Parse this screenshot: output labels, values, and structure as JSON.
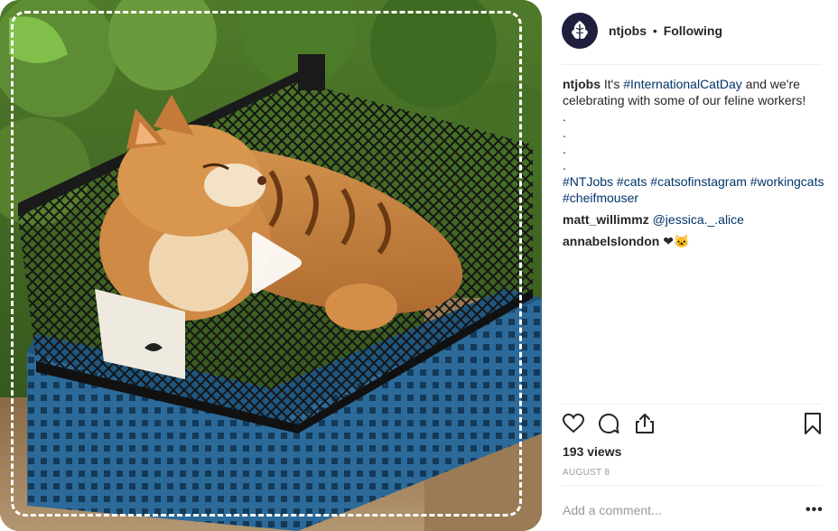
{
  "post": {
    "username": "ntjobs",
    "separator": "•",
    "follow_status": "Following",
    "caption_user": "ntjobs",
    "caption_text_1": " It's ",
    "caption_tag_1": "#InternationalCatDay",
    "caption_text_2": " and we're celebrating with some of our feline workers!",
    "caption_dots": [
      ".",
      ".",
      ".",
      "."
    ],
    "hashtags": [
      "#NTJobs",
      "#cats",
      "#catsofinstagram",
      "#workingcats",
      "#cheifmouser"
    ],
    "comments": [
      {
        "user": "matt_willimmz",
        "text": "@jessica._.alice"
      },
      {
        "user": "annabelslondon",
        "text": "❤🐱"
      }
    ],
    "views": "193 views",
    "date": "AUGUST 8",
    "add_comment_placeholder": "Add a comment...",
    "more_label": "•••"
  },
  "icons": {
    "avatar": "oak-leaf-icon",
    "like": "heart-icon",
    "comment": "comment-bubble-icon",
    "share": "share-icon",
    "save": "bookmark-icon",
    "play": "play-icon"
  },
  "colors": {
    "link": "#003569",
    "muted": "#999999",
    "text": "#262626",
    "avatar_bg": "#1f1f3d"
  }
}
